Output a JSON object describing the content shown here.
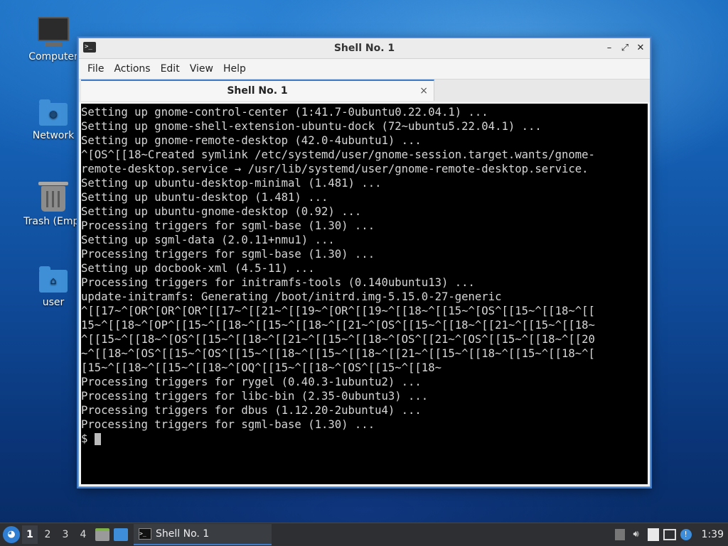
{
  "desktop": {
    "icons": [
      {
        "label": "Computer"
      },
      {
        "label": "Network"
      },
      {
        "label": "Trash (Empt"
      },
      {
        "label": "user"
      }
    ]
  },
  "window": {
    "title": "Shell No. 1",
    "menu": [
      "File",
      "Actions",
      "Edit",
      "View",
      "Help"
    ],
    "tab_label": "Shell No. 1",
    "tab_close": "×",
    "controls": {
      "minimize": "–",
      "maximize": "⤢",
      "close": "✕"
    }
  },
  "terminal": {
    "lines": [
      "Setting up gnome-control-center (1:41.7-0ubuntu0.22.04.1) ...",
      "Setting up gnome-shell-extension-ubuntu-dock (72~ubuntu5.22.04.1) ...",
      "Setting up gnome-remote-desktop (42.0-4ubuntu1) ...",
      "^[OS^[[18~Created symlink /etc/systemd/user/gnome-session.target.wants/gnome-",
      "remote-desktop.service → /usr/lib/systemd/user/gnome-remote-desktop.service.",
      "Setting up ubuntu-desktop-minimal (1.481) ...",
      "Setting up ubuntu-desktop (1.481) ...",
      "Setting up ubuntu-gnome-desktop (0.92) ...",
      "Processing triggers for sgml-base (1.30) ...",
      "Setting up sgml-data (2.0.11+nmu1) ...",
      "Processing triggers for sgml-base (1.30) ...",
      "Setting up docbook-xml (4.5-11) ...",
      "Processing triggers for initramfs-tools (0.140ubuntu13) ...",
      "update-initramfs: Generating /boot/initrd.img-5.15.0-27-generic",
      "^[[17~^[OR^[OR^[OR^[[17~^[[21~^[[19~^[OR^[[19~^[[18~^[[15~^[OS^[[15~^[[18~^[[",
      "15~^[[18~^[OP^[[15~^[[18~^[[15~^[[18~^[[21~^[OS^[[15~^[[18~^[[21~^[[15~^[[18~",
      "^[[15~^[[18~^[OS^[[15~^[[18~^[[21~^[[15~^[[18~^[OS^[[21~^[OS^[[15~^[[18~^[[20",
      "~^[[18~^[OS^[[15~^[OS^[[15~^[[18~^[[15~^[[18~^[[21~^[[15~^[[18~^[[15~^[[18~^[",
      "[15~^[[18~^[[15~^[[18~^[OQ^[[15~^[[18~^[OS^[[15~^[[18~",
      "Processing triggers for rygel (0.40.3-1ubuntu2) ...",
      "Processing triggers for libc-bin (2.35-0ubuntu3) ...",
      "Processing triggers for dbus (1.12.20-2ubuntu4) ...",
      "Processing triggers for sgml-base (1.30) ..."
    ],
    "prompt": "$"
  },
  "taskbar": {
    "workspaces": [
      "1",
      "2",
      "3",
      "4"
    ],
    "task_label": "Shell No. 1",
    "clock": "1:39"
  }
}
